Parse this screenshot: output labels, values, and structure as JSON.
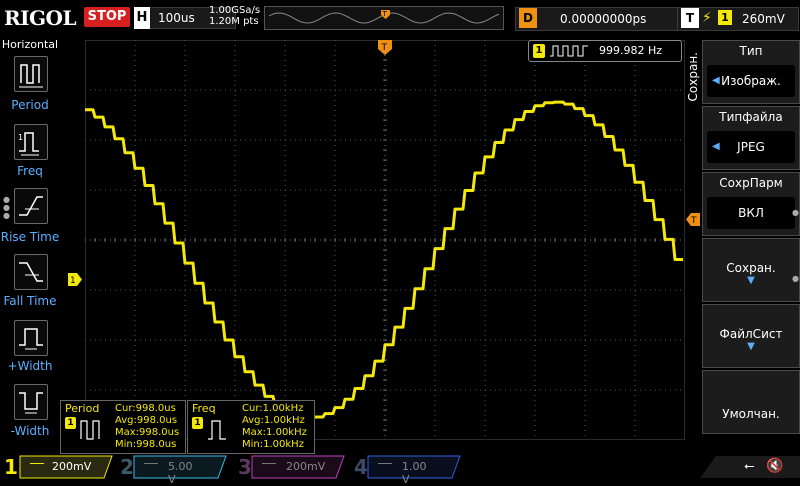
{
  "brand": "RIGOL",
  "run_state": "STOP",
  "timebase": {
    "tag": "H",
    "value": "100us"
  },
  "acquisition": {
    "sample_rate": "1.00GSa/s",
    "points": "1.20M pts"
  },
  "delay": {
    "tag": "D",
    "value": "0.00000000ps"
  },
  "trigger": {
    "tag": "T",
    "edge_icon": "rising-edge-icon",
    "source": "1",
    "level": "260mV"
  },
  "left_menu": {
    "title": "Horizontal",
    "items": [
      {
        "label": "Period",
        "icon": "period-icon",
        "selected": true
      },
      {
        "label": "Freq",
        "icon": "frequency-icon",
        "selected": false
      },
      {
        "label": "Rise Time",
        "icon": "rise-time-icon",
        "selected": false
      },
      {
        "label": "Fall Time",
        "icon": "fall-time-icon",
        "selected": false
      },
      {
        "label": "+Width",
        "icon": "positive-width-icon",
        "selected": false
      },
      {
        "label": "-Width",
        "icon": "negative-width-icon",
        "selected": false
      }
    ]
  },
  "right_menu": {
    "vertical_title": "Сохран.",
    "items": [
      {
        "title": "Тип",
        "value": "Изображ.",
        "has_left_arrow": true
      },
      {
        "title": "Типфайла",
        "value": "JPEG",
        "has_left_arrow": true
      },
      {
        "title": "СохрПарм",
        "value": "ВКЛ",
        "has_left_arrow": false
      },
      {
        "title": "",
        "value": "Сохран.",
        "has_down_arrow": true
      },
      {
        "title": "",
        "value": "ФайлСист",
        "has_down_arrow": true
      },
      {
        "title": "",
        "value": "Умолчан.",
        "has_down_arrow": false
      }
    ]
  },
  "freq_counter": {
    "channel": "1",
    "value": "999.982 Hz"
  },
  "markers": {
    "trigger_pos": "T",
    "ch1": "1",
    "trigger_level": "T"
  },
  "measurements": [
    {
      "title": "Period",
      "channel": "1",
      "cur": "Cur:998.0us",
      "avg": "Avg:998.0us",
      "max": "Max:998.0us",
      "min": "Min:998.0us"
    },
    {
      "title": "Freq",
      "channel": "1",
      "cur": "Cur:1.00kHz",
      "avg": "Avg:1.00kHz",
      "max": "Max:1.00kHz",
      "min": "Min:1.00kHz"
    }
  ],
  "channels": [
    {
      "num": "1",
      "scale": "200mV",
      "color": "#f4e80a",
      "active": true
    },
    {
      "num": "2",
      "scale": "5.00 V",
      "color": "#3fb8e8",
      "active": false
    },
    {
      "num": "3",
      "scale": "200mV",
      "color": "#c040c0",
      "active": false
    },
    {
      "num": "4",
      "scale": "1.00 V",
      "color": "#3060e0",
      "active": false
    }
  ],
  "status_icons": {
    "usb": "usb-icon",
    "speaker": "speaker-muted-icon"
  },
  "colors": {
    "ch1": "#f4e80a",
    "accent": "#f09010",
    "menu_label": "#5ab0ff",
    "stop": "#d62020"
  }
}
